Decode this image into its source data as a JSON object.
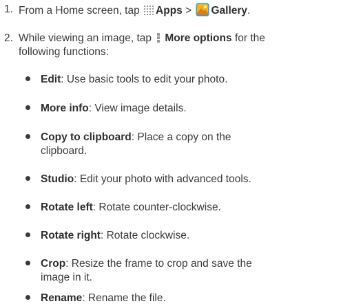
{
  "steps": [
    {
      "number": "1.",
      "prefix": "From a Home screen, tap",
      "apps_label": "Apps",
      "separator": ">",
      "gallery_label": "Gallery",
      "suffix": "."
    },
    {
      "number": "2.",
      "prefix": "While viewing an image, tap",
      "more_label": "More options",
      "suffix_line1": "for the",
      "line2": "following functions:"
    }
  ],
  "options": [
    {
      "term": "Edit",
      "desc": ": Use basic tools to edit your photo."
    },
    {
      "term": "More info",
      "desc": ": View image details."
    },
    {
      "term": "Copy to clipboard",
      "desc": ": Place a copy on the",
      "desc2": "clipboard."
    },
    {
      "term": "Studio",
      "desc": ": Edit your photo with advanced tools."
    },
    {
      "term": "Rotate left",
      "desc": ": Rotate counter-clockwise."
    },
    {
      "term": "Rotate right",
      "desc": ": Rotate clockwise."
    },
    {
      "term": "Crop",
      "desc": ": Resize the frame to crop and save the",
      "desc2": "image in it."
    },
    {
      "term": "Rename",
      "desc": ": Rename the file."
    }
  ],
  "icons": {
    "apps": "apps-grid-icon",
    "gallery": "gallery-icon",
    "more_options": "more-options-icon"
  },
  "colors": {
    "text": "#3a3a3a",
    "gallery_yellow": "#f2b51c",
    "gallery_blue": "#2f9fd8",
    "icon_gray": "#9a9a9a"
  }
}
